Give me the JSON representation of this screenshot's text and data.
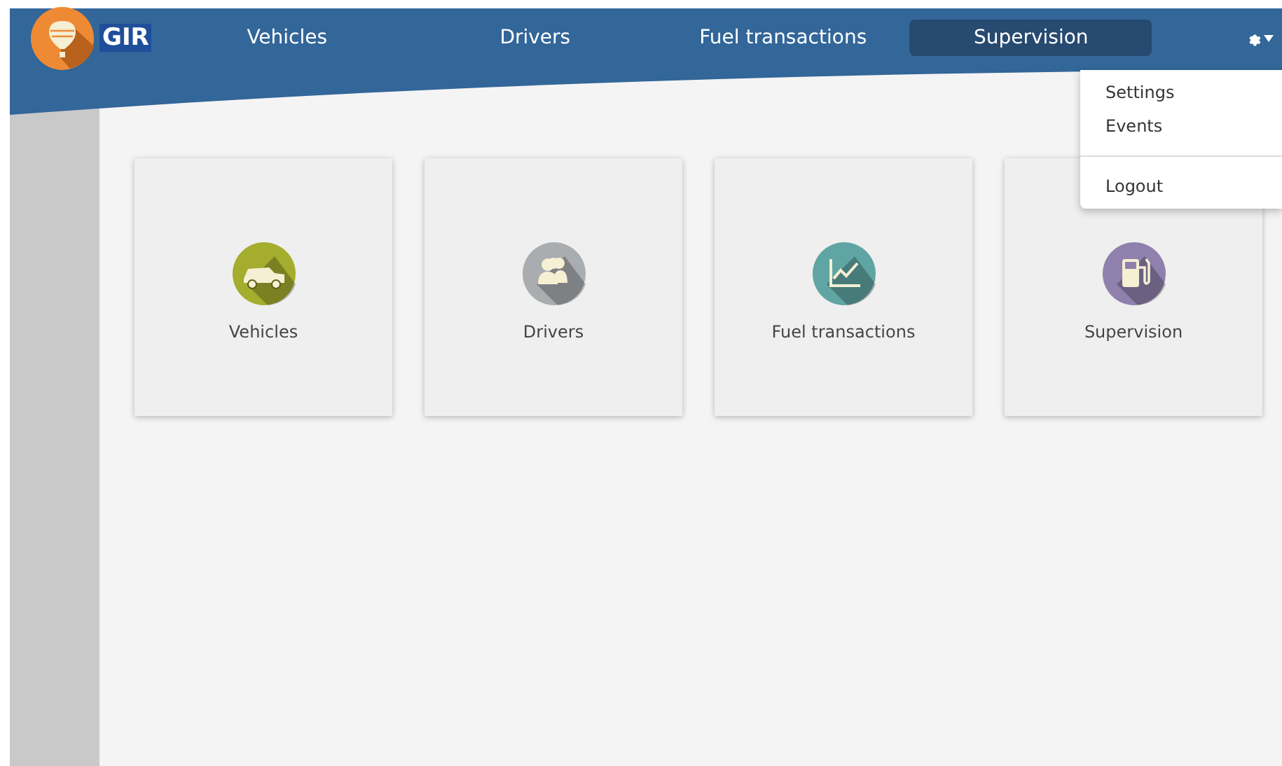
{
  "logo": {
    "text": "GIR"
  },
  "nav": [
    {
      "label": "Vehicles",
      "selected": false
    },
    {
      "label": "Drivers",
      "selected": false
    },
    {
      "label": "Fuel transactions",
      "selected": false
    },
    {
      "label": "Supervision",
      "selected": true
    }
  ],
  "settings_menu": {
    "expanded": true,
    "items": [
      {
        "label": "Settings",
        "kind": "item"
      },
      {
        "label": "Events",
        "kind": "item"
      },
      {
        "kind": "divider"
      },
      {
        "label": "Logout",
        "kind": "item"
      }
    ]
  },
  "tiles": [
    {
      "label": "Vehicles",
      "kind": "car",
      "color": "#a4ad2e"
    },
    {
      "label": "Drivers",
      "kind": "people",
      "color": "#a9adb0"
    },
    {
      "label": "Fuel transactions",
      "kind": "chart",
      "color": "#5fa5a3"
    },
    {
      "label": "Supervision",
      "kind": "pump",
      "color": "#9080ad"
    }
  ]
}
